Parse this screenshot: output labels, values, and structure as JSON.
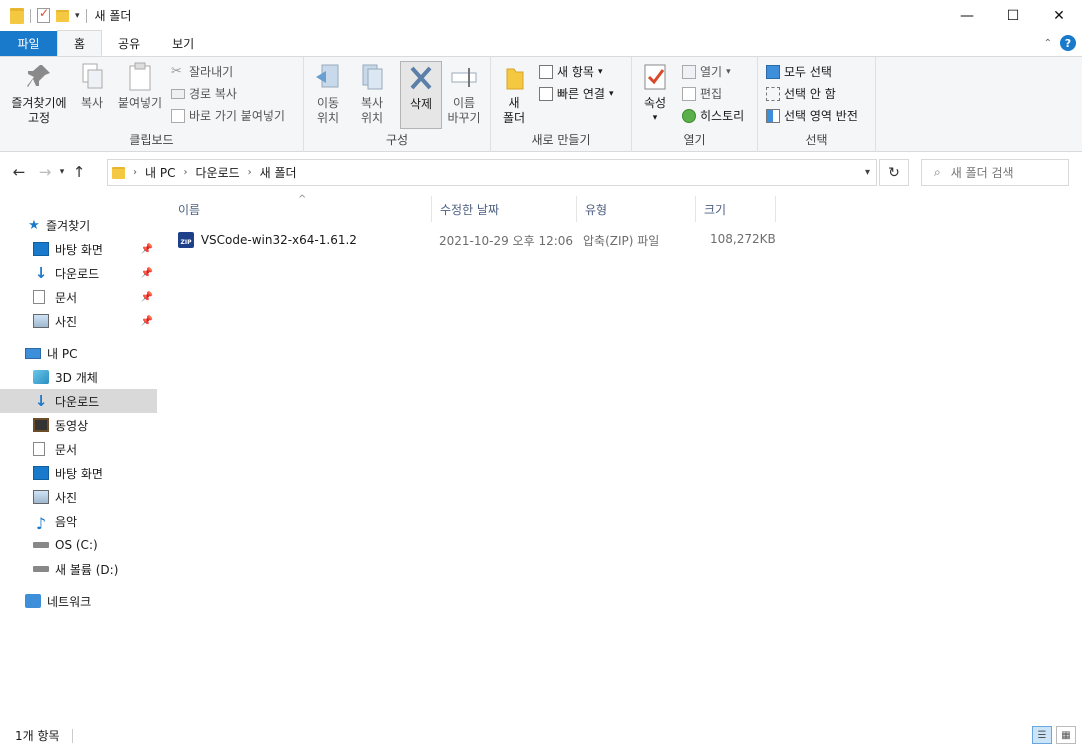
{
  "window": {
    "title": "새 폴더",
    "minimize": "—",
    "maximize": "☐",
    "close": "✕"
  },
  "tabs": {
    "file": "파일",
    "home": "홈",
    "share": "공유",
    "view": "보기",
    "help": "?",
    "collapse": "⌃"
  },
  "ribbon": {
    "clipboard": {
      "label": "클립보드",
      "pin": "즐겨찾기에\n고정",
      "copy": "복사",
      "paste": "붙여넣기",
      "cut": "잘라내기",
      "copy_path": "경로 복사",
      "paste_shortcut": "바로 가기 붙여넣기"
    },
    "organize": {
      "label": "구성",
      "move_to": "이동\n위치",
      "copy_to": "복사\n위치",
      "delete": "삭제",
      "rename": "이름\n바꾸기"
    },
    "new": {
      "label": "새로 만들기",
      "new_folder": "새\n폴더",
      "new_item": "새 항목",
      "easy_access": "빠른 연결"
    },
    "open": {
      "label": "열기",
      "properties": "속성",
      "open": "열기",
      "edit": "편집",
      "history": "히스토리"
    },
    "select": {
      "label": "선택",
      "select_all": "모두 선택",
      "select_none": "선택 안 함",
      "invert": "선택 영역 반전"
    }
  },
  "address": {
    "crumbs": [
      "내 PC",
      "다운로드",
      "새 폴더"
    ],
    "search_placeholder": "새 폴더 검색"
  },
  "nav": {
    "quick_access": "즐겨찾기",
    "qa_items": [
      "바탕 화면",
      "다운로드",
      "문서",
      "사진"
    ],
    "this_pc": "내 PC",
    "pc_items": [
      "3D 개체",
      "다운로드",
      "동영상",
      "문서",
      "바탕 화면",
      "사진",
      "음악",
      "OS (C:)",
      "새 볼륨 (D:)"
    ],
    "network": "네트워크"
  },
  "columns": {
    "name": "이름",
    "modified": "수정한 날짜",
    "type": "유형",
    "size": "크기"
  },
  "files": [
    {
      "name": "VSCode-win32-x64-1.61.2",
      "modified": "2021-10-29 오후 12:06",
      "type": "압축(ZIP) 파일",
      "size": "108,272KB",
      "icon_badge": "ZIP"
    }
  ],
  "status": {
    "count": "1개 항목"
  }
}
